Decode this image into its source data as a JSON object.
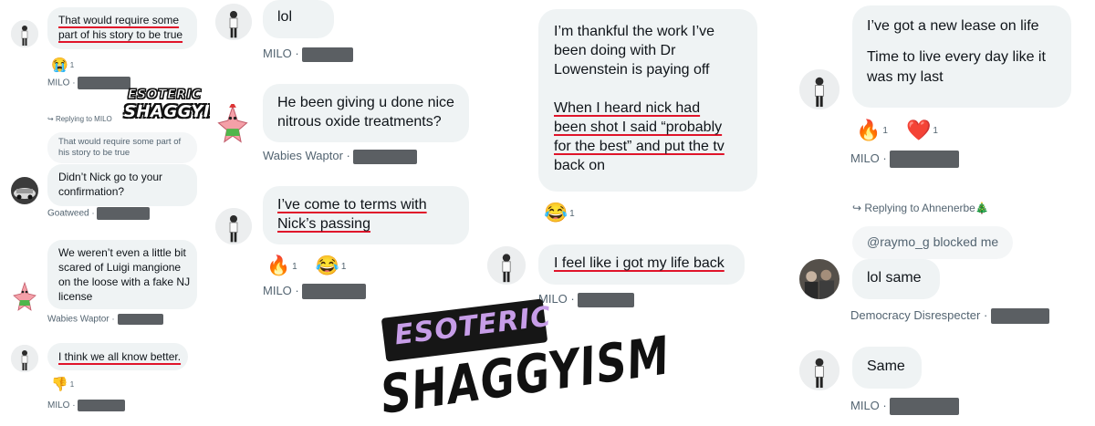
{
  "panel1": {
    "m1": {
      "lines": [
        "That would require some",
        "part of his story to be true"
      ],
      "reaction": {
        "emoji": "😭",
        "count": "1"
      },
      "author": "MILO"
    },
    "reply_label": "Replying to MILO",
    "m2": {
      "quote_lines": [
        "That would require some part of",
        "his story to be true"
      ],
      "lines": [
        "Didn’t Nick go to your",
        "confirmation?"
      ],
      "author": "Goatweed"
    },
    "m3": {
      "lines": [
        "We weren’t even a little bit",
        "scared of Luigi mangione",
        "on the loose with a fake NJ",
        "license"
      ],
      "author": "Wabies Waptor"
    },
    "m4": {
      "lines": [
        "I think we all know better."
      ],
      "reaction": {
        "emoji": "👎",
        "count": "1"
      },
      "author": "MILO"
    }
  },
  "panel2": {
    "m1": {
      "text": "lol",
      "author": "MILO"
    },
    "m2": {
      "lines": [
        "He been giving u done nice",
        "nitrous oxide treatments?"
      ],
      "author": "Wabies Waptor"
    },
    "m3": {
      "lines": [
        "I’ve come to terms with",
        "Nick’s passing"
      ],
      "reactions": [
        {
          "emoji": "🔥",
          "count": "1"
        },
        {
          "emoji": "😂",
          "count": "1"
        }
      ],
      "author": "MILO"
    }
  },
  "panel3": {
    "m1": {
      "lines_a": [
        "I’m thankful the work I’ve",
        "been doing with Dr",
        "Lowenstein is paying off"
      ],
      "lines_b": [
        "When I heard nick had",
        "been shot I said “probably",
        "for the best” and put the tv"
      ],
      "line_c": "back on",
      "reaction": {
        "emoji": "😂",
        "count": "1"
      }
    },
    "m2": {
      "text": "I feel like i got my life back",
      "author": "MILO"
    }
  },
  "panel4": {
    "m1": {
      "lines": [
        "I’ve got a new lease on life",
        "",
        "Time to live every day like it",
        "was my last"
      ],
      "reactions": [
        {
          "emoji": "🔥",
          "count": "1"
        },
        {
          "emoji": "❤️",
          "count": "1"
        }
      ],
      "author": "MILO"
    },
    "reply_label": "Replying to Ahnenerbe🎄",
    "m2": {
      "quote": "@raymo_g blocked me",
      "text": "lol same",
      "author": "Democracy Disrespecter"
    },
    "m3": {
      "text": "Same",
      "author": "MILO"
    }
  },
  "stamp_small": {
    "line1": "ESOTERIC",
    "line2": "SHAGGYISM"
  },
  "stamp_big": {
    "line1": "ESOTERIC",
    "line2": "SHAGGYISM"
  },
  "colors": {
    "bubble": "#eff3f4",
    "underline": "#e0142a",
    "meta": "#536471",
    "stamp_purple": "#c79de8",
    "stamp_dark": "#161616"
  }
}
